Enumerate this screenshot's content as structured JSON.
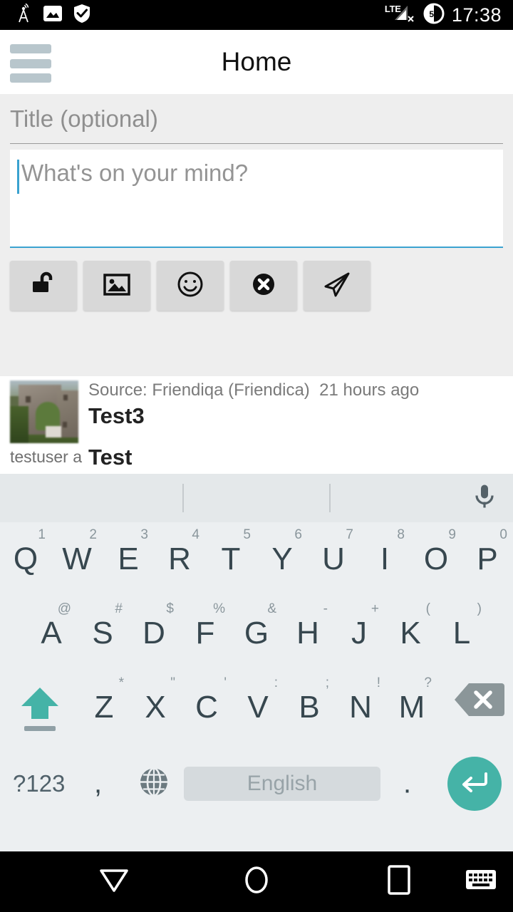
{
  "statusbar": {
    "icons": [
      "cell-tower-icon",
      "image-icon",
      "shield-check-icon"
    ],
    "network_label": "LTE",
    "battery_level": "50",
    "time": "17:38"
  },
  "appbar": {
    "menu_icon": "hamburger-menu-icon",
    "title": "Home"
  },
  "composer": {
    "title_placeholder": "Title (optional)",
    "title_value": "",
    "body_placeholder": "What's on your mind?",
    "body_value": "",
    "tools": [
      {
        "name": "unlock-icon",
        "label": "Unlock"
      },
      {
        "name": "image-icon",
        "label": "Add image"
      },
      {
        "name": "smiley-icon",
        "label": "Emoticon"
      },
      {
        "name": "cancel-icon",
        "label": "Cancel"
      },
      {
        "name": "send-icon",
        "label": "Send"
      }
    ]
  },
  "feed": {
    "posts": [
      {
        "source": "Source: Friendiqa (Friendica)",
        "time": "21 hours ago",
        "title": "Test3",
        "author": "testuser a",
        "text": "Test"
      }
    ]
  },
  "keyboard": {
    "mic_icon": "microphone-icon",
    "rows": [
      [
        {
          "key": "Q",
          "alt": "1"
        },
        {
          "key": "W",
          "alt": "2"
        },
        {
          "key": "E",
          "alt": "3"
        },
        {
          "key": "R",
          "alt": "4"
        },
        {
          "key": "T",
          "alt": "5"
        },
        {
          "key": "Y",
          "alt": "6"
        },
        {
          "key": "U",
          "alt": "7"
        },
        {
          "key": "I",
          "alt": "8"
        },
        {
          "key": "O",
          "alt": "9"
        },
        {
          "key": "P",
          "alt": "0"
        }
      ],
      [
        {
          "key": "A",
          "alt": "@"
        },
        {
          "key": "S",
          "alt": "#"
        },
        {
          "key": "D",
          "alt": "$"
        },
        {
          "key": "F",
          "alt": "%"
        },
        {
          "key": "G",
          "alt": "&"
        },
        {
          "key": "H",
          "alt": "-"
        },
        {
          "key": "J",
          "alt": "+"
        },
        {
          "key": "K",
          "alt": "("
        },
        {
          "key": "L",
          "alt": ")"
        }
      ],
      [
        {
          "key": "Z",
          "alt": "*"
        },
        {
          "key": "X",
          "alt": "\""
        },
        {
          "key": "C",
          "alt": "'"
        },
        {
          "key": "V",
          "alt": ":"
        },
        {
          "key": "B",
          "alt": ";"
        },
        {
          "key": "N",
          "alt": "!"
        },
        {
          "key": "M",
          "alt": "?"
        }
      ]
    ],
    "shift_icon": "shift-arrow-icon",
    "backspace_icon": "backspace-icon",
    "symbols_key": "?123",
    "comma_key": ",",
    "globe_icon": "language-globe-icon",
    "space_label": "English",
    "period_key": ".",
    "enter_icon": "enter-return-icon"
  },
  "navbar": {
    "back_icon": "nav-back-icon",
    "home_icon": "nav-home-icon",
    "recents_icon": "nav-recents-icon",
    "hide_keyboard_icon": "hide-keyboard-icon"
  },
  "colors": {
    "accent_teal": "#45b3a7",
    "accent_blue": "#3aa2d0",
    "composer_bg": "#eeeeee",
    "keyboard_bg": "#eceff1"
  }
}
